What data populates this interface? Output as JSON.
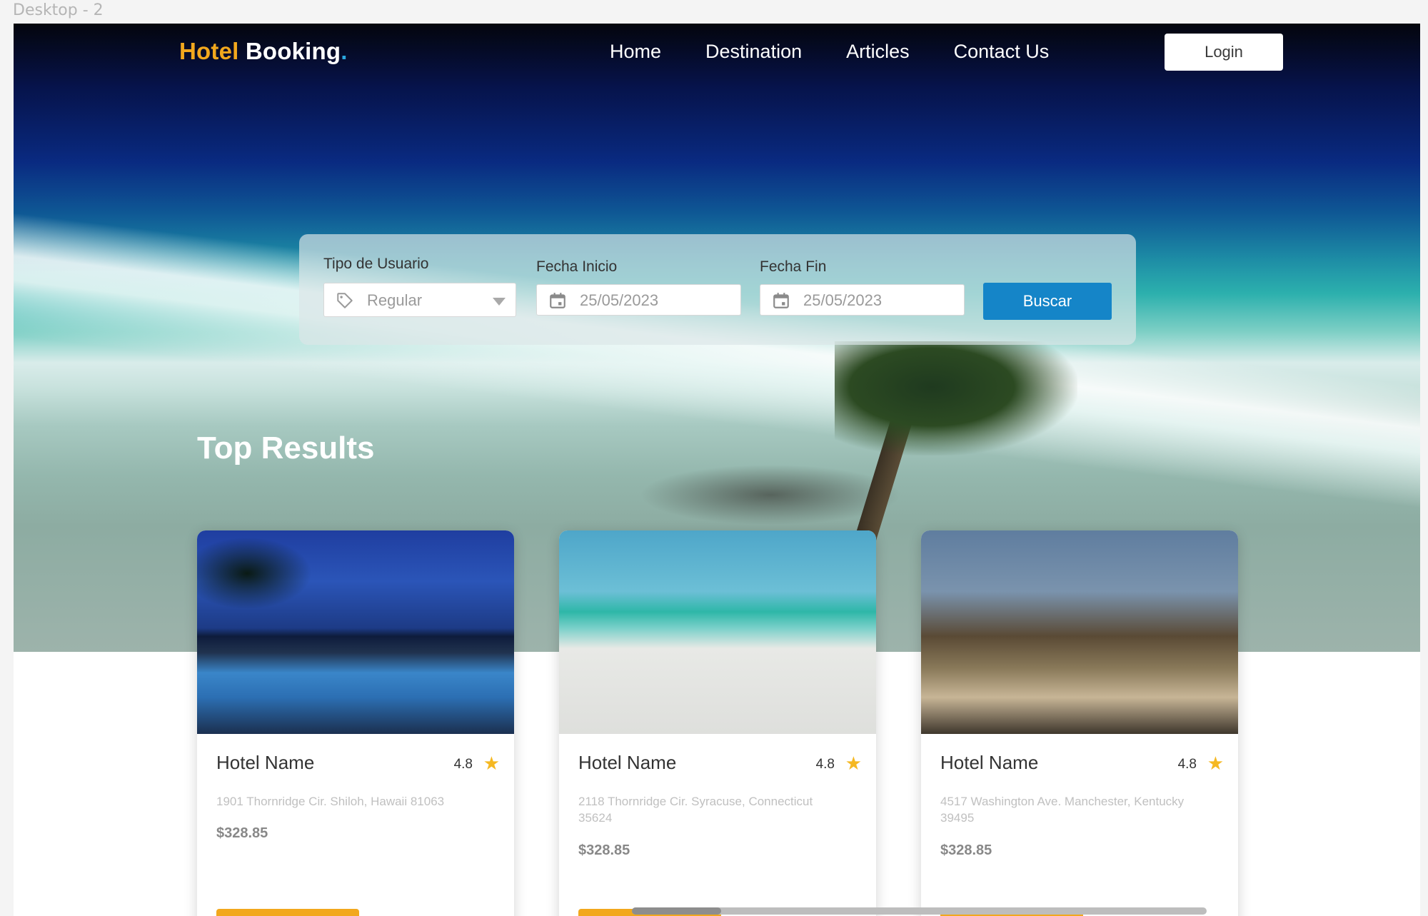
{
  "frame": {
    "label": "Desktop - 2"
  },
  "nav": {
    "logo": {
      "part1": "Hotel",
      "part2": "Booking",
      "dot": "."
    },
    "links": [
      "Home",
      "Destination",
      "Articles",
      "Contact Us"
    ],
    "login_label": "Login"
  },
  "search": {
    "user_type_label": "Tipo de Usuario",
    "user_type_value": "Regular",
    "start_label": "Fecha Inicio",
    "start_value": "25/05/2023",
    "end_label": "Fecha Fin",
    "end_value": "25/05/2023",
    "button_label": "Buscar"
  },
  "results": {
    "title": "Top Results",
    "cards": [
      {
        "name": "Hotel Name",
        "rating": "4.8",
        "address": "1901 Thornridge Cir. Shiloh, Hawaii 81063",
        "price": "$328.85"
      },
      {
        "name": "Hotel Name",
        "rating": "4.8",
        "address": "2118 Thornridge Cir. Syracuse, Connecticut 35624",
        "price": "$328.85"
      },
      {
        "name": "Hotel Name",
        "rating": "4.8",
        "address": "4517 Washington Ave. Manchester, Kentucky 39495",
        "price": "$328.85"
      }
    ]
  },
  "colors": {
    "accent_orange": "#f2a81d",
    "primary_blue": "#1585c8",
    "star": "#f5b822"
  },
  "icons": {
    "tag": "tag-icon",
    "calendar": "calendar-icon",
    "star": "star-icon",
    "dropdown": "chevron-down-icon"
  }
}
